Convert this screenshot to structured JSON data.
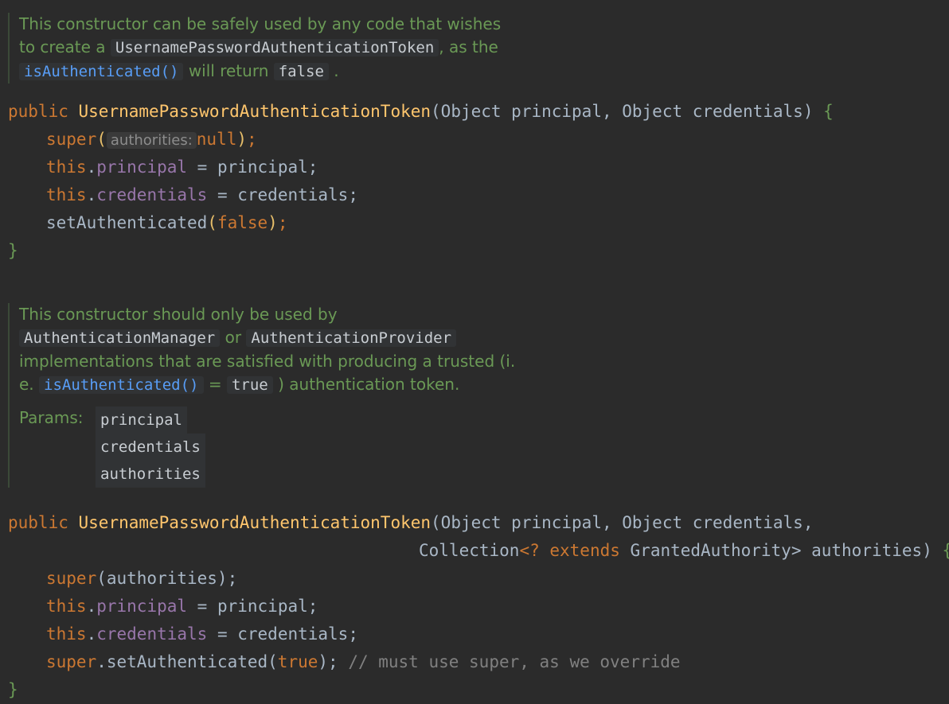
{
  "doc1": {
    "line1": "This constructor can be safely used by any code that wishes",
    "line2_prefix": "to create a ",
    "line2_code": "UsernamePasswordAuthenticationToken",
    "line2_suffix": ", as the",
    "line3_code1": "isAuthenticated()",
    "line3_mid": " will return ",
    "line3_code2": "false",
    "line3_end": " ."
  },
  "ctor1": {
    "kw_public": "public",
    "name": "UsernamePasswordAuthenticationToken",
    "params": "(Object principal, Object credentials)",
    "open": " {",
    "super_kw": "super",
    "super_hint": "authorities:",
    "super_arg": "null",
    "this_kw": "this",
    "field_principal": "principal",
    "assign_principal": " = principal;",
    "field_credentials": "credentials",
    "assign_credentials": " = credentials;",
    "set_auth": "setAuthenticated",
    "false_kw": "false",
    "close": "}"
  },
  "doc2": {
    "line1": "This constructor should only be used by",
    "code_manager": "AuthenticationManager",
    "or": " or ",
    "code_provider": "AuthenticationProvider",
    "line3": "implementations that are satisfied with producing a trusted (i.",
    "line4_prefix": "e. ",
    "line4_code1": "isAuthenticated()",
    "line4_eq": " = ",
    "line4_code2": "true",
    "line4_suffix": " ) authentication token.",
    "params_label": "Params:",
    "params": [
      "principal",
      "credentials",
      "authorities"
    ]
  },
  "ctor2": {
    "kw_public": "public",
    "name": "UsernamePasswordAuthenticationToken",
    "params_line1": "(Object principal, Object credentials,",
    "params_line2_a": "Collection",
    "params_line2_b": "<? ",
    "extends_kw": "extends",
    "params_line2_c": " GrantedAuthority",
    "params_line2_d": "> authorities)",
    "open": " {",
    "super_kw": "super",
    "super_arg": "(authorities);",
    "this_kw": "this",
    "field_principal": "principal",
    "assign_principal": " = principal;",
    "field_credentials": "credentials",
    "assign_credentials": " = credentials;",
    "super_set": ".setAuthenticated(",
    "true_kw": "true",
    "super_set_end": ");",
    "comment": " // must use super, as we override",
    "close": "}"
  }
}
